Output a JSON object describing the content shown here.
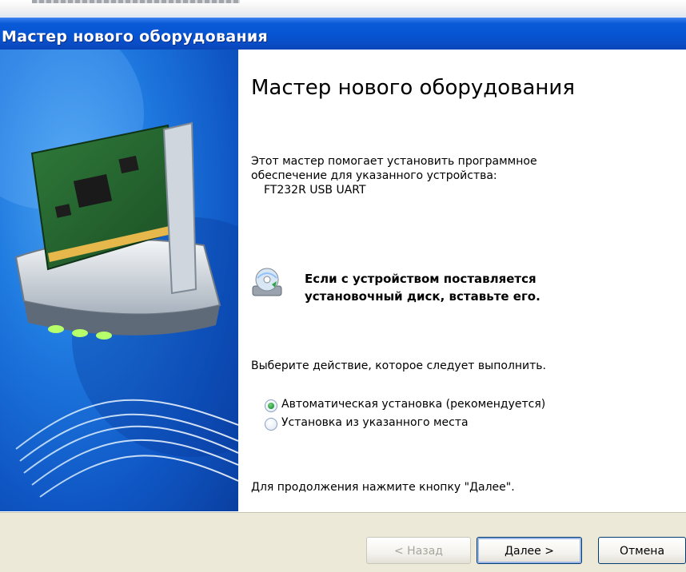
{
  "window": {
    "title": "Мастер нового оборудования"
  },
  "main": {
    "heading": "Мастер нового оборудования",
    "intro_line1": "Этот мастер помогает установить программное",
    "intro_line2": "обеспечение для указанного устройства:",
    "device_name": "FT232R USB UART",
    "cd_notice_line1": "Если с устройством поставляется",
    "cd_notice_line2": "установочный диск, вставьте его.",
    "choose_prompt": "Выберите действие, которое следует выполнить.",
    "options": [
      {
        "label": "Автоматическая установка (рекомендуется)",
        "selected": true
      },
      {
        "label": "Установка из указанного места",
        "selected": false
      }
    ],
    "continue_hint": "Для продолжения нажмите кнопку \"Далее\"."
  },
  "footer": {
    "back_label": "< Назад",
    "next_label": "Далее >",
    "cancel_label": "Отмена"
  },
  "icons": {
    "side_art": "network-card-illustration",
    "cd": "cd-drive-icon"
  },
  "colors": {
    "titlebar": "#0654d2",
    "side_panel": "#1f7ae0",
    "footer_bg": "#ece9d8",
    "radio_selected": "#2ea34a"
  }
}
